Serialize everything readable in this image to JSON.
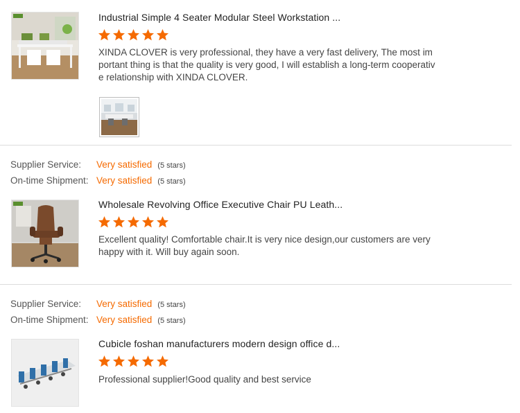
{
  "colors": {
    "accent": "#f56a00",
    "star": "#f56a00",
    "divider": "#dcdcdc"
  },
  "reviews": [
    {
      "product_title": "Industrial Simple 4 Seater Modular Steel Workstation ...",
      "stars": 5,
      "comment": "XINDA CLOVER is very professional, they have a very fast delivery, The most important thing is that the quality is very good, I will establish a long-term cooperative relationship with XINDA CLOVER."
    },
    {
      "product_title": "Wholesale Revolving Office Executive Chair PU Leath...",
      "stars": 5,
      "comment": "Excellent quality! Comfortable chair.It is very nice design,our customers are very happy with it. Will buy again soon."
    },
    {
      "product_title": "Cubicle foshan manufacturers modern design office d...",
      "stars": 5,
      "comment": "Professional supplier!Good quality and best service"
    }
  ],
  "ratings": [
    {
      "supplier_label": "Supplier Service:",
      "supplier_value": "Very satisfied",
      "supplier_count": "(5 stars)",
      "shipment_label": "On-time Shipment:",
      "shipment_value": "Very satisfied",
      "shipment_count": "(5 stars)"
    },
    {
      "supplier_label": "Supplier Service:",
      "supplier_value": "Very satisfied",
      "supplier_count": "(5 stars)",
      "shipment_label": "On-time Shipment:",
      "shipment_value": "Very satisfied",
      "shipment_count": "(5 stars)"
    }
  ]
}
